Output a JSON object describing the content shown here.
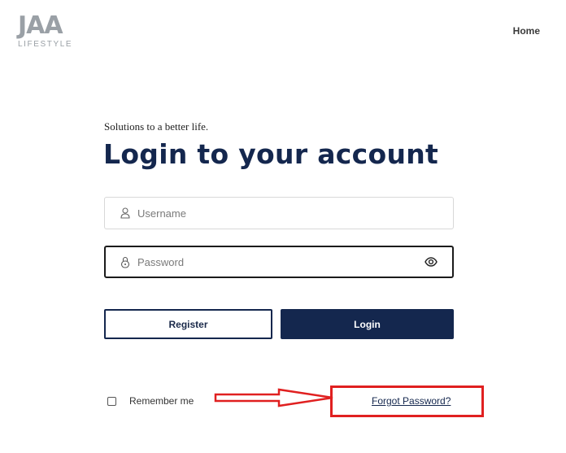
{
  "brand": {
    "logo_mark": "JAA",
    "logo_sub": "LIFESTYLE"
  },
  "nav": {
    "home_label": "Home"
  },
  "login": {
    "tagline": "Solutions to a better life.",
    "title": "Login to your account",
    "username": {
      "value": "",
      "placeholder": "Username",
      "icon": "user-icon"
    },
    "password": {
      "value": "",
      "placeholder": "Password",
      "icon": "lock-icon",
      "toggle_icon": "eye-icon"
    },
    "register_label": "Register",
    "login_label": "Login",
    "remember_label": "Remember me",
    "remember_checked": false,
    "forgot_label": "Forgot Password?"
  },
  "annotation": {
    "color": "#e02020",
    "arrow_icon": "right-arrow-outline",
    "target": "forgot-password-link"
  },
  "colors": {
    "primary": "#14274e",
    "logo": "#9aa0a6"
  }
}
